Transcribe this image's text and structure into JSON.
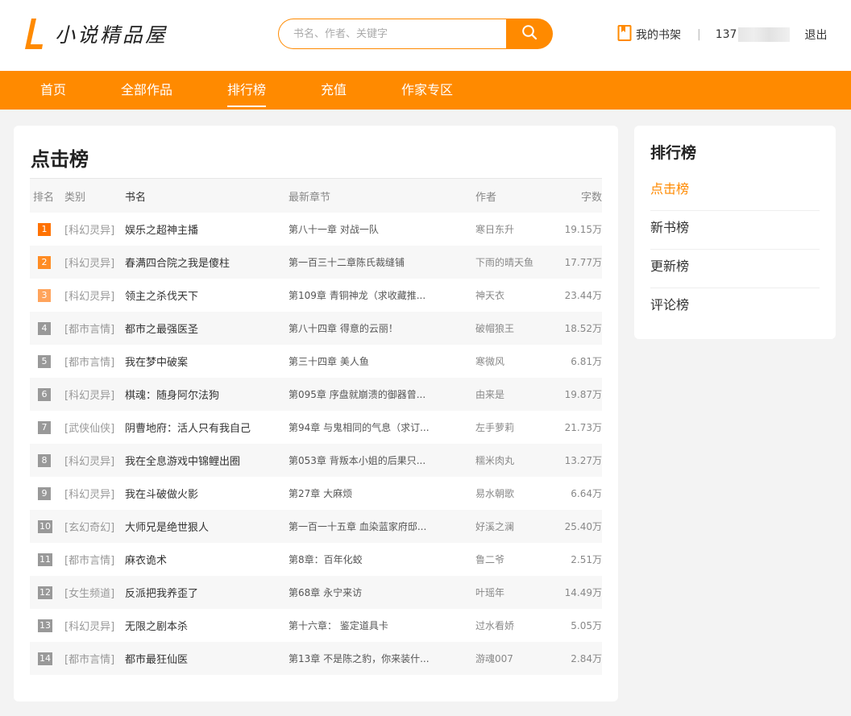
{
  "brand": {
    "name": "小说精品屋",
    "accent": "#ff8a00"
  },
  "search": {
    "placeholder": "书名、作者、关键字",
    "value": ""
  },
  "user": {
    "shelf_label": "我的书架",
    "separator": "|",
    "phone_prefix": "137",
    "logout_label": "退出"
  },
  "nav": {
    "items": [
      {
        "label": "首页"
      },
      {
        "label": "全部作品"
      },
      {
        "label": "排行榜"
      },
      {
        "label": "充值"
      },
      {
        "label": "作家专区"
      }
    ],
    "active": "排行榜"
  },
  "main": {
    "title": "点击榜",
    "headers": {
      "rank": "排名",
      "category": "类别",
      "name": "书名",
      "chapter": "最新章节",
      "author": "作者",
      "words": "字数"
    },
    "rows": [
      {
        "rank": "1",
        "category": "[科幻灵异]",
        "name": "娱乐之超神主播",
        "chapter": "第八十一章 对战一队",
        "author": "寒日东升",
        "words": "19.15万"
      },
      {
        "rank": "2",
        "category": "[科幻灵异]",
        "name": "春满四合院之我是傻柱",
        "chapter": "第一百三十二章陈氏裁缝铺",
        "author": "下雨的晴天鱼",
        "words": "17.77万"
      },
      {
        "rank": "3",
        "category": "[科幻灵异]",
        "name": "领主之杀伐天下",
        "chapter": "第109章 青铜神龙（求收藏推...",
        "author": "神天衣",
        "words": "23.44万"
      },
      {
        "rank": "4",
        "category": "[都市言情]",
        "name": "都市之最强医圣",
        "chapter": "第八十四章 得意的云丽！",
        "author": "破帽狼王",
        "words": "18.52万"
      },
      {
        "rank": "5",
        "category": "[都市言情]",
        "name": "我在梦中破案",
        "chapter": "第三十四章 美人鱼",
        "author": "寒微风",
        "words": "6.81万"
      },
      {
        "rank": "6",
        "category": "[科幻灵异]",
        "name": "棋魂：随身阿尔法狗",
        "chapter": "第095章 序盘就崩溃的御器曾...",
        "author": "由来是",
        "words": "19.87万"
      },
      {
        "rank": "7",
        "category": "[武侠仙侠]",
        "name": "阴曹地府：活人只有我自己",
        "chapter": "第94章 与鬼相同的气息（求订...",
        "author": "左手萝莉",
        "words": "21.73万"
      },
      {
        "rank": "8",
        "category": "[科幻灵异]",
        "name": "我在全息游戏中锦鲤出圈",
        "chapter": "第053章 背叛本小姐的后果只...",
        "author": "糯米肉丸",
        "words": "13.27万"
      },
      {
        "rank": "9",
        "category": "[科幻灵异]",
        "name": "我在斗破做火影",
        "chapter": "第27章 大麻烦",
        "author": "易水朝歌",
        "words": "6.64万"
      },
      {
        "rank": "10",
        "category": "[玄幻奇幻]",
        "name": "大师兄是绝世狠人",
        "chapter": "第一百一十五章 血染蓝家府邸...",
        "author": "好溪之澜",
        "words": "25.40万"
      },
      {
        "rank": "11",
        "category": "[都市言情]",
        "name": "麻衣诡术",
        "chapter": "第8章：百年化蛟",
        "author": "鲁二爷",
        "words": "2.51万"
      },
      {
        "rank": "12",
        "category": "[女生频道]",
        "name": "反派把我养歪了",
        "chapter": "第68章 永宁来访",
        "author": "叶瑶年",
        "words": "14.49万"
      },
      {
        "rank": "13",
        "category": "[科幻灵异]",
        "name": "无限之剧本杀",
        "chapter": "第十六章： 鉴定道具卡",
        "author": "过水看娇",
        "words": "5.05万"
      },
      {
        "rank": "14",
        "category": "[都市言情]",
        "name": "都市最狂仙医",
        "chapter": "第13章 不是陈之豹，你来装什...",
        "author": "游魂007",
        "words": "2.84万"
      }
    ],
    "badge_colors": {
      "first": "#ff7200",
      "second": "#ff8c24",
      "third": "#ffa45c",
      "other": "#999999"
    }
  },
  "side": {
    "title": "排行榜",
    "items": [
      {
        "label": "点击榜"
      },
      {
        "label": "新书榜"
      },
      {
        "label": "更新榜"
      },
      {
        "label": "评论榜"
      }
    ],
    "active": "点击榜"
  }
}
